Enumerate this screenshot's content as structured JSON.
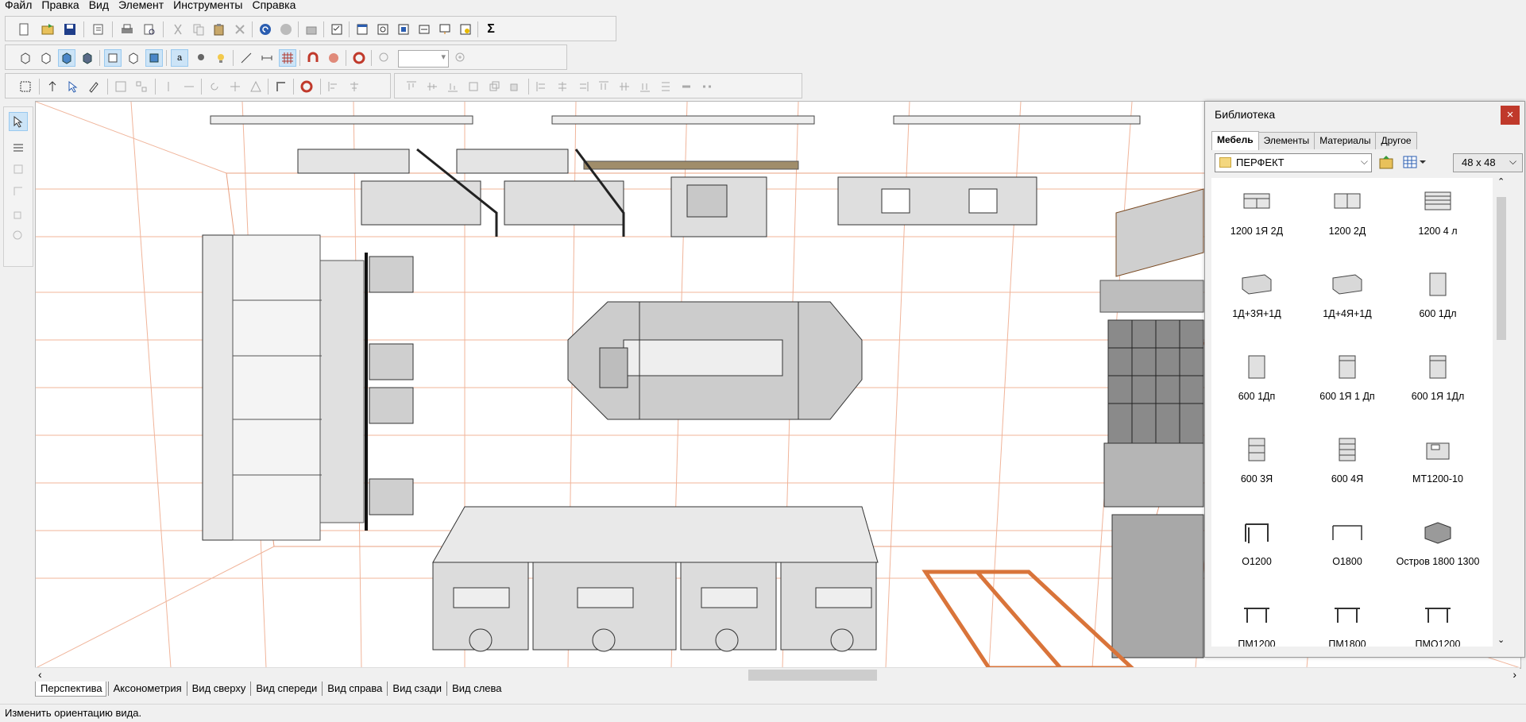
{
  "menu": [
    "Файл",
    "Правка",
    "Вид",
    "Элемент",
    "Инструменты",
    "Справка"
  ],
  "toolbar": {
    "zoom_value": "",
    "sum_symbol": "Σ"
  },
  "view_tabs": [
    "Перспектива",
    "Аксонометрия",
    "Вид сверху",
    "Вид спереди",
    "Вид справа",
    "Вид сзади",
    "Вид слева"
  ],
  "active_view_tab": "Перспектива",
  "status_text": "Изменить ориентацию вида.",
  "library": {
    "title": "Библиотека",
    "close_symbol": "×",
    "tabs": [
      "Мебель",
      "Элементы",
      "Материалы",
      "Другое"
    ],
    "active_tab": "Мебель",
    "category": "ПЕРФЕКТ",
    "icon_size": "48 x  48",
    "items": [
      {
        "label": "1200 1Я 2Д",
        "icon": "wide-cabinet-icon"
      },
      {
        "label": "1200 2Д",
        "icon": "wide-cabinet-icon"
      },
      {
        "label": "1200 4 л",
        "icon": "drawer-cabinet-icon"
      },
      {
        "label": "1Д+3Я+1Д",
        "icon": "long-cabinet-icon"
      },
      {
        "label": "1Д+4Я+1Д",
        "icon": "long-cabinet-icon"
      },
      {
        "label": "600 1Дл",
        "icon": "single-cabinet-icon"
      },
      {
        "label": "600 1Дп",
        "icon": "single-cabinet-icon"
      },
      {
        "label": "600 1Я 1 Дп",
        "icon": "single-cabinet-icon"
      },
      {
        "label": "600 1Я 1Дл",
        "icon": "single-cabinet-icon"
      },
      {
        "label": "600 3Я",
        "icon": "drawer-unit-icon"
      },
      {
        "label": "600 4Я",
        "icon": "drawer-unit-icon"
      },
      {
        "label": "МТ1200-10",
        "icon": "sink-unit-icon"
      },
      {
        "label": "О1200",
        "icon": "table-frame-icon"
      },
      {
        "label": "О1800",
        "icon": "table-frame-icon"
      },
      {
        "label": "Остров 1800 1300",
        "icon": "island-icon"
      },
      {
        "label": "ПМ1200",
        "icon": "bench-icon"
      },
      {
        "label": "ПМ1800",
        "icon": "bench-icon"
      },
      {
        "label": "ПМО1200",
        "icon": "bench-icon"
      }
    ]
  },
  "colors": {
    "grid_lines": "#f0b49a",
    "furniture_fill": "#dedede",
    "door_accent": "#d9743a",
    "library_close": "#c0392b"
  }
}
